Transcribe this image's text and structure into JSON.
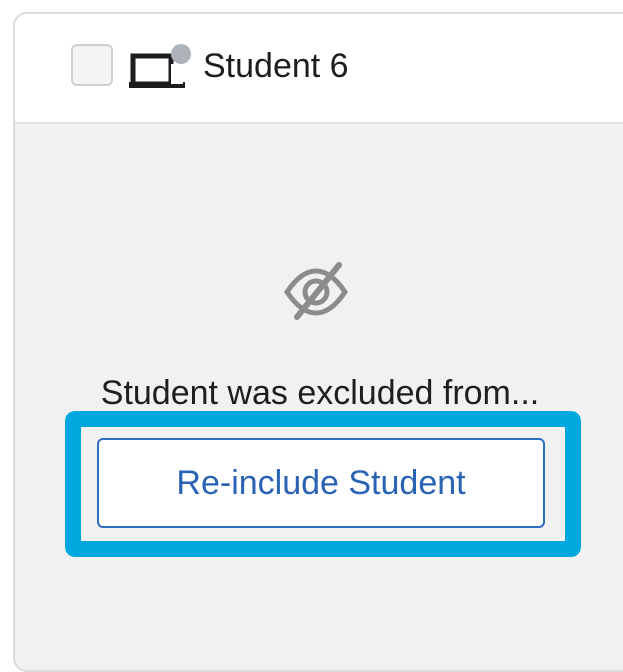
{
  "student_card": {
    "checked": false,
    "device_icon": "device-status-icon",
    "name": "Student 6",
    "status_icon": "eye-slash-icon",
    "status_text": "Student was excluded from...",
    "action_label": "Re-include Student"
  },
  "colors": {
    "highlight": "#00a8e0",
    "button_text": "#2a63b3",
    "card_background": "#f1f1f1",
    "status_dot": "#aeb3ba"
  }
}
